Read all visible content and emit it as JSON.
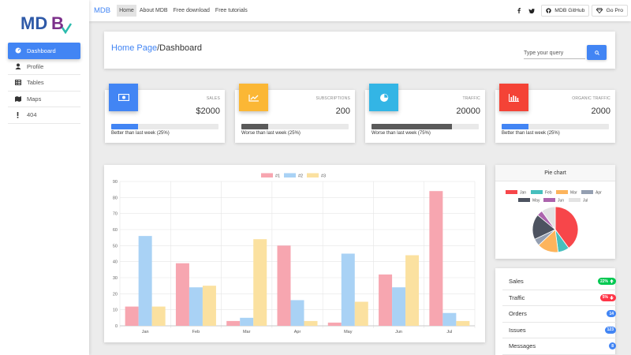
{
  "sidebar": {
    "logo_text": "MDB",
    "items": [
      {
        "label": "Dashboard",
        "icon": "dashboard-icon",
        "active": true
      },
      {
        "label": "Profile",
        "icon": "user-icon",
        "active": false
      },
      {
        "label": "Tables",
        "icon": "table-icon",
        "active": false
      },
      {
        "label": "Maps",
        "icon": "map-icon",
        "active": false
      },
      {
        "label": "404",
        "icon": "exclamation-icon",
        "active": false
      }
    ]
  },
  "topbar": {
    "brand": "MDB",
    "links": [
      "Home",
      "About MDB",
      "Free download",
      "Free tutorials"
    ],
    "active_link": "Home",
    "github_label": "MDB GitHub",
    "gopro_label": "Go Pro"
  },
  "header": {
    "breadcrumb_link": "Home Page",
    "breadcrumb_separator": "/",
    "breadcrumb_current": "Dashboard",
    "search_placeholder": "Type your query"
  },
  "stats": [
    {
      "label": "SALES",
      "value": "$2000",
      "desc": "Better than last week (25%)",
      "progress": 25,
      "color": "#4285f4",
      "bar_color": "#4285f4",
      "icon": "money-icon"
    },
    {
      "label": "SUBSCRIPTIONS",
      "value": "200",
      "desc": "Worse than last week (25%)",
      "progress": 25,
      "color": "#fbb735",
      "bar_color": "#5a5a5a",
      "icon": "chart-line-icon"
    },
    {
      "label": "TRAFFIC",
      "value": "20000",
      "desc": "Worse than last week (75%)",
      "progress": 75,
      "color": "#33b5e5",
      "bar_color": "#5a5a5a",
      "icon": "pie-chart-icon"
    },
    {
      "label": "ORGANIC TRAFFIC",
      "value": "2000",
      "desc": "Better than last week (25%)",
      "progress": 25,
      "color": "#f44336",
      "bar_color": "#4285f4",
      "icon": "bar-chart-icon"
    }
  ],
  "chart_data": [
    {
      "type": "bar",
      "categories": [
        "Jan",
        "Feb",
        "Mar",
        "Apr",
        "May",
        "Jun",
        "Jul"
      ],
      "series": [
        {
          "name": "#1",
          "values": [
            12,
            39,
            3,
            50,
            2,
            32,
            84
          ],
          "color": "#f7a6b0"
        },
        {
          "name": "#2",
          "values": [
            56,
            24,
            5,
            16,
            45,
            24,
            8
          ],
          "color": "#a9d2f5"
        },
        {
          "name": "#3",
          "values": [
            12,
            25,
            54,
            3,
            15,
            44,
            3
          ],
          "color": "#fbe1a0"
        }
      ],
      "ylim": [
        0,
        90
      ],
      "yticks": [
        0,
        10,
        20,
        30,
        40,
        50,
        60,
        70,
        80,
        90
      ],
      "grid": true,
      "legend": "top"
    },
    {
      "type": "pie",
      "title": "Pie chart",
      "categories": [
        "Jan",
        "Feb",
        "Mar",
        "Apr",
        "May",
        "Jun",
        "Jul"
      ],
      "values": [
        40,
        8,
        15,
        5,
        18,
        4,
        10
      ],
      "colors": [
        "#f7464a",
        "#46bfbd",
        "#fdb45c",
        "#949fb1",
        "#4d5360",
        "#ac64ad",
        "#e3e3e3"
      ],
      "legend": "top"
    }
  ],
  "summary_list": [
    {
      "label": "Sales",
      "badge": "22%",
      "trend": "up",
      "color": "#00c851"
    },
    {
      "label": "Traffic",
      "badge": "5%",
      "trend": "down",
      "color": "#ff3547"
    },
    {
      "label": "Orders",
      "badge": "14",
      "trend": "",
      "color": "#4285f4"
    },
    {
      "label": "Issues",
      "badge": "123",
      "trend": "",
      "color": "#4285f4"
    },
    {
      "label": "Messages",
      "badge": "8",
      "trend": "",
      "color": "#4285f4"
    }
  ]
}
